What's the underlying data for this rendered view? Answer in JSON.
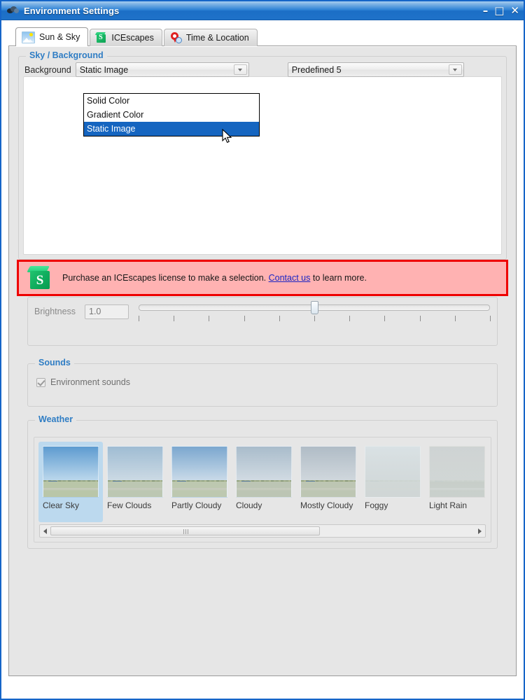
{
  "window": {
    "title": "Environment Settings",
    "icon": "clouds-icon",
    "controls": {
      "minimize": "–",
      "maximize": "□",
      "close": "✕"
    }
  },
  "tabs": [
    {
      "label": "Sun & Sky",
      "icon": "sun-sky-icon",
      "active": true
    },
    {
      "label": "ICEscapes",
      "icon": "icescapes-cube-icon",
      "active": false
    },
    {
      "label": "Time & Location",
      "icon": "location-pin-clock-icon",
      "active": false
    }
  ],
  "sky_group": {
    "legend": "Sky / Background",
    "background_label": "Background",
    "background_combo": {
      "value": "Static Image",
      "options": [
        "Solid Color",
        "Gradient Color",
        "Static Image"
      ],
      "selected_option": "Static Image",
      "expanded": true
    },
    "predefined_combo": {
      "value": "Predefined 5"
    }
  },
  "license_banner": {
    "icon": "icescapes-cube-icon",
    "text_before": "Purchase an ICEscapes license to make a selection. ",
    "link_text": "Contact us",
    "text_after": " to learn more.",
    "border_color": "#ee0000",
    "background_color": "#ffb2b2",
    "link_color": "#1a24c4"
  },
  "brightness": {
    "label": "Brightness",
    "value": "1.0",
    "slider": {
      "min": 0,
      "max": 10,
      "position": 5,
      "tick_count": 11
    }
  },
  "sounds_group": {
    "legend": "Sounds",
    "checkbox": {
      "label": "Environment sounds",
      "checked": true,
      "disabled": true
    }
  },
  "weather_group": {
    "legend": "Weather",
    "selected": "Clear Sky",
    "items": [
      {
        "label": "Clear Sky",
        "sky_top": "#5d9bd0",
        "sky_bottom": "#c3dcee",
        "ground": "#b9c6a8",
        "selected": true
      },
      {
        "label": "Few Clouds",
        "sky_top": "#9fbcd3",
        "sky_bottom": "#cfdce5",
        "ground": "#bcc7b2",
        "selected": false
      },
      {
        "label": "Partly Cloudy",
        "sky_top": "#7ba7cf",
        "sky_bottom": "#cfdeea",
        "ground": "#bdc8b0",
        "selected": false
      },
      {
        "label": "Cloudy",
        "sky_top": "#a9bccb",
        "sky_bottom": "#d4dde4",
        "ground": "#bcc5b4",
        "selected": false
      },
      {
        "label": "Mostly Cloudy",
        "sky_top": "#b0bcc6",
        "sky_bottom": "#d2d9de",
        "ground": "#bdc6b3",
        "selected": false
      },
      {
        "label": "Foggy",
        "sky_top": "#cfd9dd",
        "sky_bottom": "#c8d2d4",
        "ground": "#c3cbc6",
        "selected": false
      },
      {
        "label": "Light Rain",
        "sky_top": "#b6b9b7",
        "sky_bottom": "#c2c4bf",
        "ground": "#9aa48c",
        "selected": false
      }
    ],
    "scrollbar": {
      "left_arrow": "scroll-left-arrow",
      "right_arrow": "scroll-right-arrow"
    }
  },
  "colors": {
    "accent_blue": "#2f7dc4",
    "title_gradient_top": "#7fb4e6",
    "title_gradient_bottom": "#1f72c9",
    "selection_blue": "#1565c0",
    "window_border": "#1565c8",
    "panel_bg": "#e6e6e6"
  }
}
